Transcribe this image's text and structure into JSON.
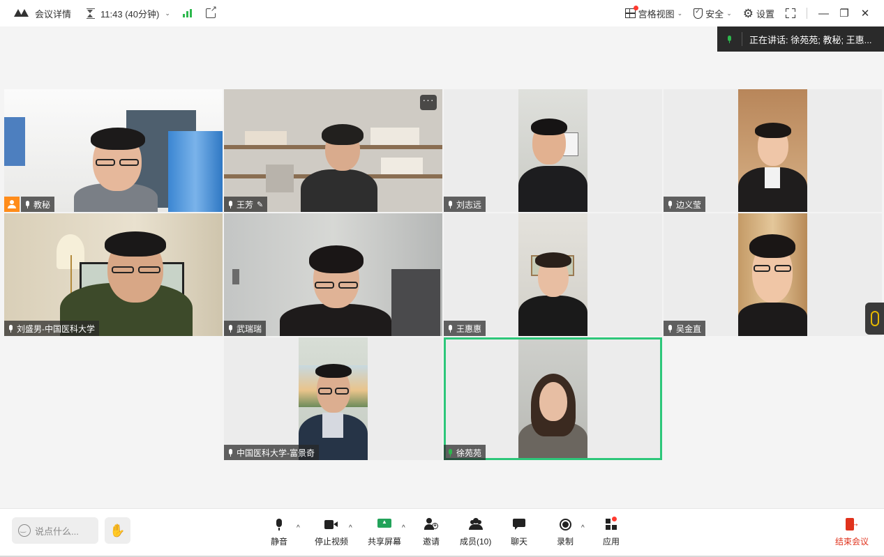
{
  "titlebar": {
    "meeting_details": "会议详情",
    "time": "11:43 (40分钟)",
    "view_mode": "宫格视图",
    "security": "安全",
    "settings": "设置"
  },
  "speaking_banner": {
    "text": "正在讲话:  徐苑苑; 教秘; 王惠..."
  },
  "participants": [
    {
      "name": "教秘",
      "host": true
    },
    {
      "name": "王芳"
    },
    {
      "name": "刘志远"
    },
    {
      "name": "边义莹"
    },
    {
      "name": "刘盛男-中国医科大学"
    },
    {
      "name": "武瑞瑞"
    },
    {
      "name": "王惠惠"
    },
    {
      "name": "吴金直"
    },
    {
      "name": "中国医科大学-富景奇"
    },
    {
      "name": "徐苑苑",
      "active_speaker": true
    }
  ],
  "toolbar": {
    "chat_placeholder": "说点什么...",
    "mute": "静音",
    "stop_video": "停止视频",
    "share_screen": "共享屏幕",
    "invite": "邀请",
    "members": "成员(10)",
    "chat": "聊天",
    "record": "录制",
    "apps": "应用",
    "end_meeting": "结束会议"
  },
  "colors": {
    "active_border": "#2dc77a",
    "host_badge": "#ff8c1a",
    "end_meeting": "#e0321c",
    "signal": "#2db84d"
  }
}
